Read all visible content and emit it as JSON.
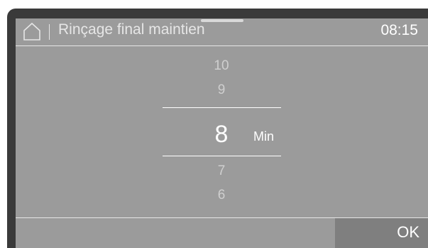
{
  "header": {
    "home_icon": "home-icon",
    "title": "Rinçage final maintien",
    "time": "08:15"
  },
  "picker": {
    "items_above": [
      "10",
      "9"
    ],
    "selected": "8",
    "unit": "Min",
    "items_below": [
      "7",
      "6"
    ]
  },
  "footer": {
    "ok_label": "OK"
  },
  "colors": {
    "screen_background": "#9b9b9b",
    "bezel": "#3a3a3a",
    "button_background": "#7f7f7f",
    "text_primary": "#ffffff",
    "text_secondary": "#cfcfcf"
  }
}
